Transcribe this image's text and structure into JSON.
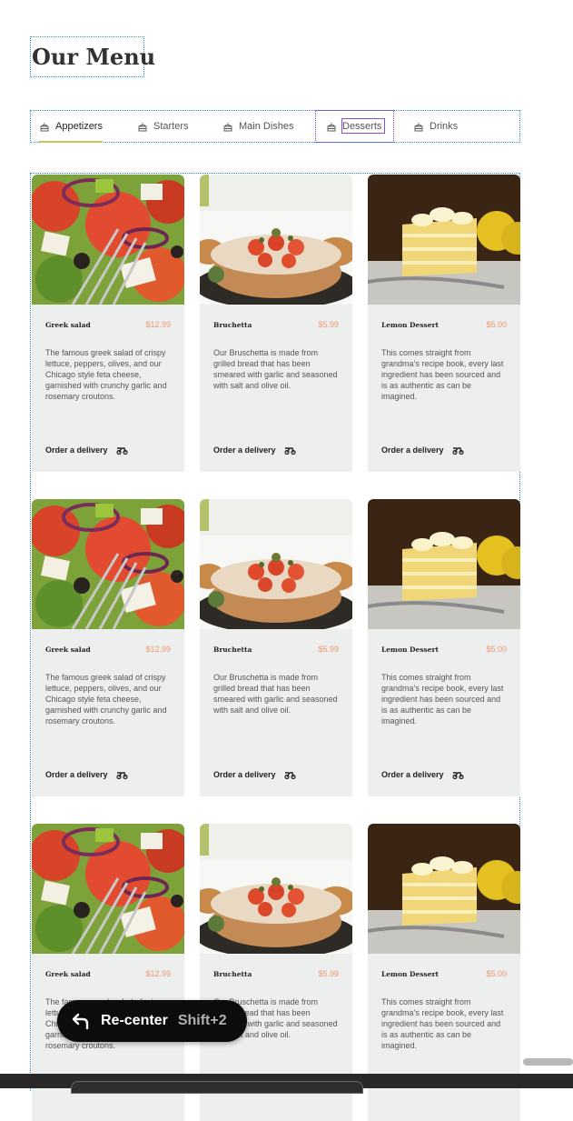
{
  "title": "Our Menu",
  "tabs": [
    {
      "label": "Appetizers",
      "active": true
    },
    {
      "label": "Starters",
      "active": false
    },
    {
      "label": "Main Dishes",
      "active": false
    },
    {
      "label": "Desserts",
      "active": false
    },
    {
      "label": "Drinks",
      "active": false
    }
  ],
  "items": {
    "greek": {
      "name": "Greek salad",
      "price": "$12.99",
      "description": "The famous greek salad of crispy lettuce, peppers, olives, and our Chicago style feta cheese, garnished with crunchy garlic and rosemary croutons.",
      "cta": "Order a delivery"
    },
    "bruchetta": {
      "name": "Bruchetta",
      "price": "$5.99",
      "description": "Our Bruschetta is made from grilled bread that has been smeared with garlic and seasoned with salt and olive oil.",
      "cta": "Order a delivery"
    },
    "lemon": {
      "name": "Lemon Dessert",
      "price": "$5.00",
      "description": "This comes straight from grandma’s recipe book, every last ingredient has been sourced and is as authentic as can be imagined.",
      "cta": "Order a delivery"
    }
  },
  "recenter": {
    "label": "Re-center",
    "shortcut": "Shift+2",
    "icon": "undo-arrow-icon"
  },
  "colors": {
    "accent_price": "#ee9972",
    "card_bg": "#edeeee",
    "tab_underline": "#c9c95a",
    "selection_outline": "#2d8fd5"
  }
}
